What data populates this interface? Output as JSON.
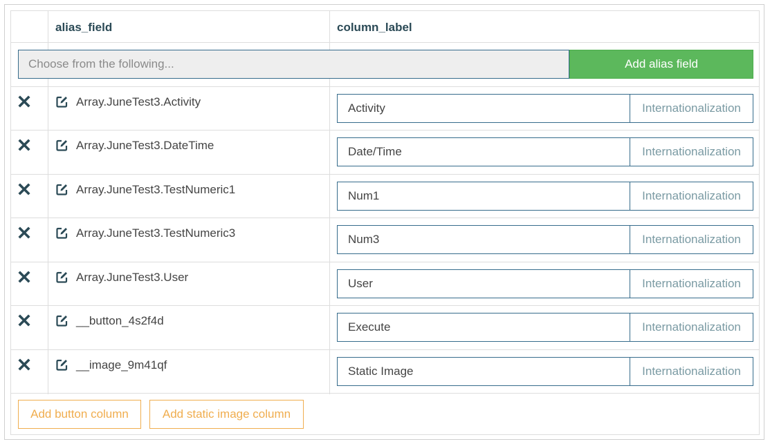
{
  "header": {
    "col_alias": "alias_field",
    "col_label": "column_label"
  },
  "add_row": {
    "placeholder": "Choose from the following...",
    "add_button": "Add alias field"
  },
  "rows": [
    {
      "alias": "Array.JuneTest3.Activity",
      "label": "Activity",
      "i18n": "Internationalization"
    },
    {
      "alias": "Array.JuneTest3.DateTime",
      "label": "Date/Time",
      "i18n": "Internationalization"
    },
    {
      "alias": "Array.JuneTest3.TestNumeric1",
      "label": "Num1",
      "i18n": "Internationalization"
    },
    {
      "alias": "Array.JuneTest3.TestNumeric3",
      "label": "Num3",
      "i18n": "Internationalization"
    },
    {
      "alias": "Array.JuneTest3.User",
      "label": "User",
      "i18n": "Internationalization"
    },
    {
      "alias": "__button_4s2f4d",
      "label": "Execute",
      "i18n": "Internationalization"
    },
    {
      "alias": "__image_9m41qf",
      "label": "Static Image",
      "i18n": "Internationalization"
    }
  ],
  "footer": {
    "add_button_column": "Add button column",
    "add_static_image_column": "Add static image column"
  },
  "colors": {
    "accent_green": "#5cb85c",
    "warning_orange": "#f0ad4e",
    "input_border": "#356b8b",
    "header_text": "#2b4a56"
  },
  "icons": {
    "remove": "close-x-icon",
    "edit": "edit-icon"
  }
}
